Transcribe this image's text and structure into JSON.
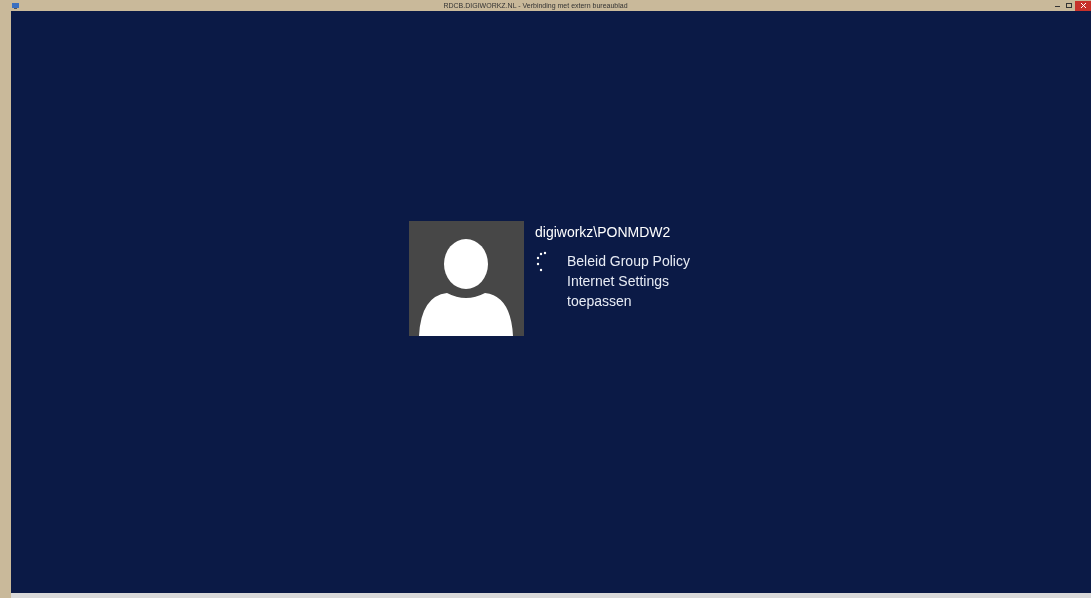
{
  "window": {
    "title": "RDCB.DIGIWORKZ.NL - Verbinding met extern bureaublad"
  },
  "login": {
    "username": "digiworkz\\PONMDW2",
    "status": "Beleid Group Policy Internet Settings toepassen"
  }
}
